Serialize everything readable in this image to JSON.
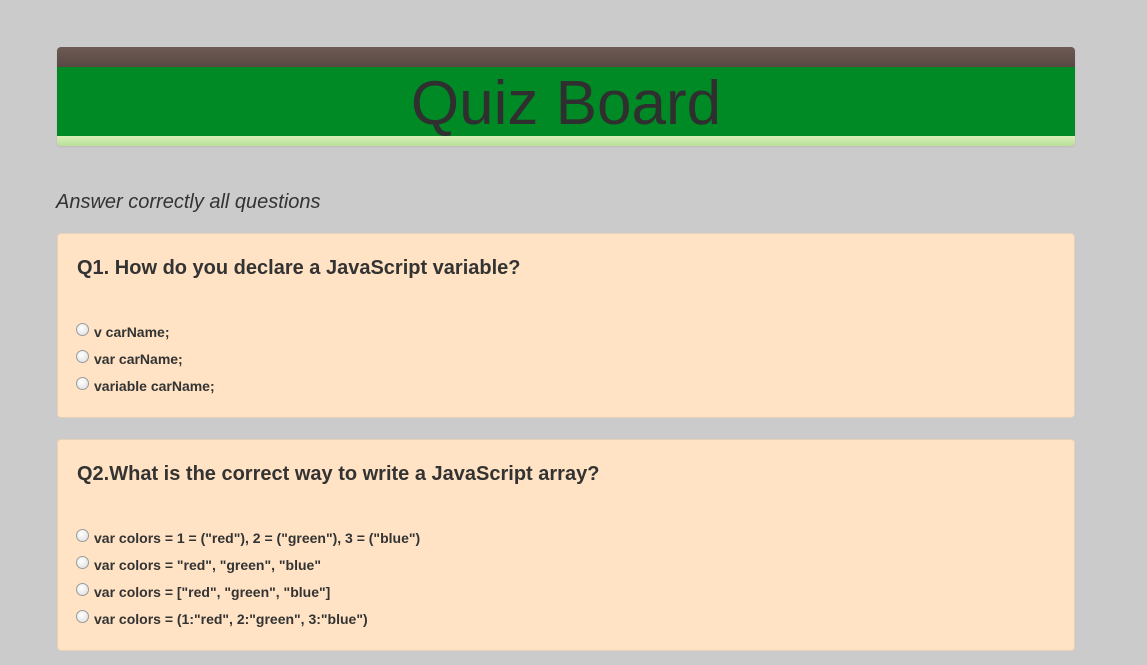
{
  "header": {
    "title": "Quiz Board"
  },
  "subtitle": "Answer correctly all questions",
  "questions": [
    {
      "title": "Q1. How do you declare a JavaScript variable?",
      "options": [
        "v carName;",
        "var carName;",
        "variable carName;"
      ]
    },
    {
      "title": "Q2.What is the correct way to write a JavaScript array?",
      "options": [
        "var colors = 1 = (\"red\"), 2 = (\"green\"), 3 = (\"blue\")",
        "var colors = \"red\", \"green\", \"blue\"",
        "var colors = [\"red\", \"green\", \"blue\"]",
        "var colors = (1:\"red\", 2:\"green\", 3:\"blue\")"
      ]
    }
  ],
  "colors": {
    "page_background": "#cbcbcb",
    "header_green": "#008a26",
    "header_top_brown": "#5a4844",
    "header_bottom_light_green": "#c8e8a8",
    "panel_background": "#ffe3c4",
    "text": "#333333"
  }
}
